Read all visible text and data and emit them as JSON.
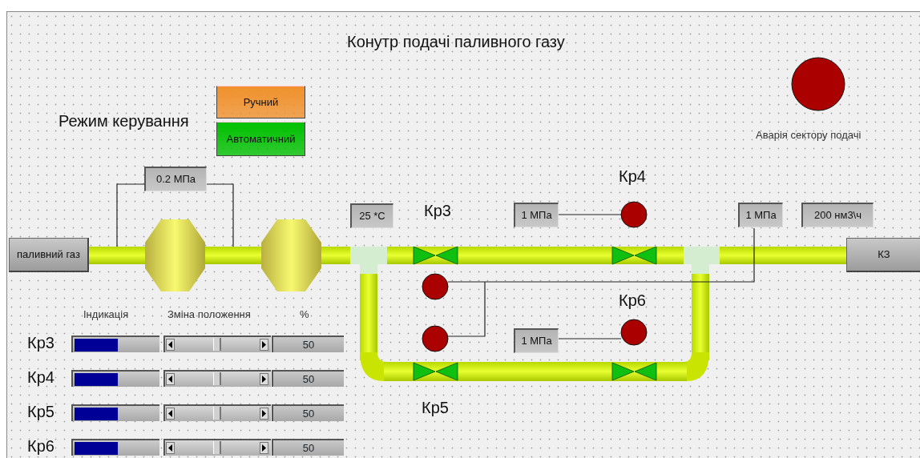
{
  "title": "Конутр подачі паливного газу",
  "mode": {
    "label": "Режим керування",
    "buttons": [
      {
        "label": "Ручний",
        "color": "#f0902c"
      },
      {
        "label": "Автоматичний",
        "color": "#00c000"
      }
    ]
  },
  "alarm": {
    "label": "Аварія сектору подачі",
    "on": true
  },
  "source": {
    "label": "паливний газ"
  },
  "sink": {
    "label": "КЗ"
  },
  "readouts": [
    {
      "text": "0.2 МПа"
    },
    {
      "text": "25 *C"
    },
    {
      "text": "1 МПа"
    },
    {
      "text": "1 МПа"
    },
    {
      "text": "200 нм3\\ч"
    },
    {
      "text": "1 МПа"
    }
  ],
  "valve_labels": [
    {
      "text": "Кр3"
    },
    {
      "text": "Кр4"
    },
    {
      "text": "Кр6"
    },
    {
      "text": "Кр5"
    }
  ],
  "lamps": [
    {
      "on": true
    },
    {
      "on": true
    },
    {
      "on": true
    },
    {
      "on": true
    }
  ],
  "slider_headers": [
    "Індикація",
    "Зміна положення",
    "%"
  ],
  "sliders": [
    {
      "label": "Кр3",
      "level": 0.5,
      "reading": "50"
    },
    {
      "label": "Кр4",
      "level": 0.5,
      "reading": "50"
    },
    {
      "label": "Кр5",
      "level": 0.5,
      "reading": "50"
    },
    {
      "label": "Кр6",
      "level": 0.5,
      "reading": "50"
    }
  ]
}
